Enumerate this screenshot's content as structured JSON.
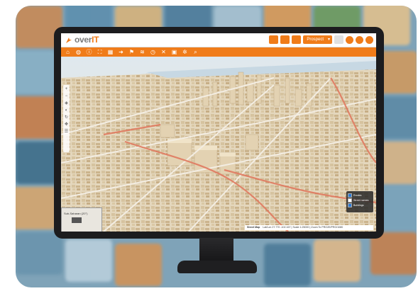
{
  "app": {
    "logo_text": "over",
    "logo_accent": "IT",
    "profile_select": "Prospect",
    "brand_color": "#f07c1a"
  },
  "toolbar": {
    "icons": [
      "home-icon",
      "globe-icon",
      "info-icon",
      "fullscreen-icon",
      "grid-icon",
      "arrow-icon",
      "measure-icon",
      "layers-icon",
      "clock-icon",
      "tools-icon",
      "print-icon",
      "settings-icon",
      "search-icon"
    ]
  },
  "map": {
    "minimap_label": "Sub-Saharan (20°)",
    "layers": [
      {
        "label": "Routes",
        "checked": true
      },
      {
        "label": "Street names",
        "checked": false
      },
      {
        "label": "Buildings",
        "checked": true
      }
    ],
    "status": {
      "source": "Street Map",
      "coords": "Lat/Lon 27.770 -102.167 | Scale 1:25000 | Zoom To PRO2E/PRO/1080"
    }
  }
}
